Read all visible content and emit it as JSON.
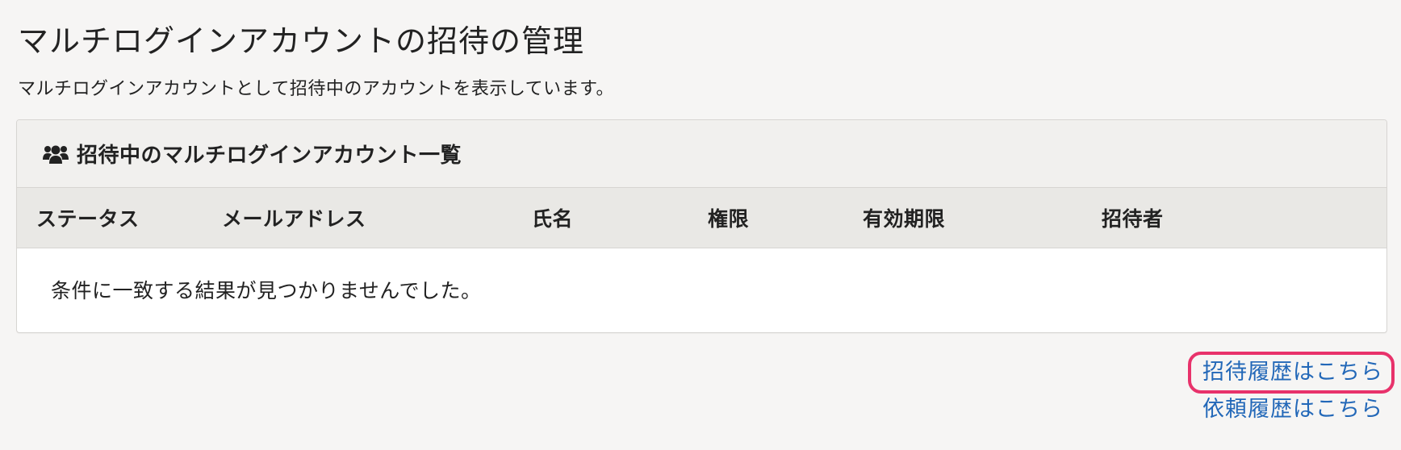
{
  "page": {
    "title": "マルチログインアカウントの招待の管理",
    "description": "マルチログインアカウントとして招待中のアカウントを表示しています。"
  },
  "panel": {
    "icon": "users-icon",
    "title": "招待中のマルチログインアカウント一覧",
    "columns": [
      "ステータス",
      "メールアドレス",
      "氏名",
      "権限",
      "有効期限",
      "招待者"
    ],
    "empty_message": "条件に一致する結果が見つかりませんでした。"
  },
  "links": {
    "invite_history": "招待履歴はこちら",
    "request_history": "依頼履歴はこちら"
  },
  "colors": {
    "link": "#2368b8",
    "highlight": "#e8326b"
  }
}
